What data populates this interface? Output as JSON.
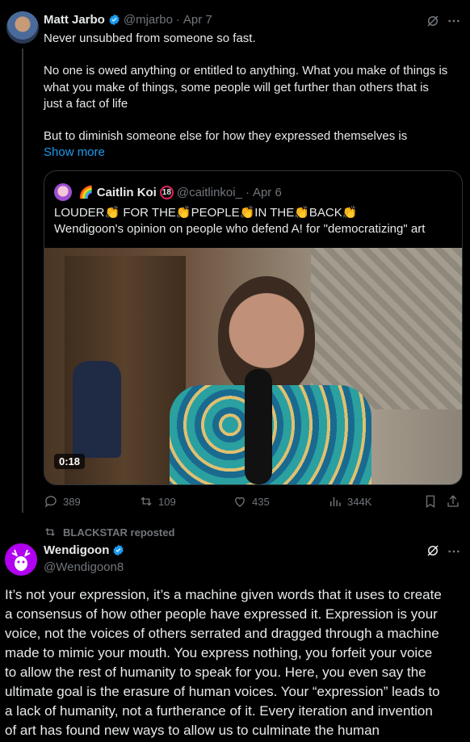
{
  "post1": {
    "author_name": "Matt Jarbo",
    "handle": "@mjarbo",
    "separator": "·",
    "date": "Apr 7",
    "text_lines": [
      "Never unsubbed from someone so fast.",
      "No one is owed anything or entitled to anything. What you make of things is",
      "what you make of things, some people will get further than others that is",
      "just a fact of life",
      "But to diminish someone else for how they expressed themselves is"
    ],
    "show_more": "Show more",
    "quote": {
      "author_emoji": "🌈",
      "author_name": "Caitlin Koi",
      "badge": "18",
      "handle": "@caitlinkoi_",
      "separator": "·",
      "date": "Apr 6",
      "line1": "LOUDER👏 FOR THE👏PEOPLE👏IN THE👏BACK👏",
      "line2": "Wendigoon's opinion on people who defend A! for \"democratizing\" art",
      "video_duration": "0:18"
    },
    "actions": {
      "replies": "389",
      "reposts": "109",
      "likes": "435",
      "views": "344K"
    }
  },
  "repost_label": "BLACKSTAR reposted",
  "post2": {
    "author_name": "Wendigoon",
    "handle": "@Wendigoon8",
    "text_lines": [
      "It’s not your expression, it’s a machine given words that it uses to create",
      "a consensus of how other people have expressed it. Expression is your",
      "voice, not the voices of others serrated and dragged through a machine",
      "made to mimic your mouth. You express nothing, you forfeit your voice",
      "to allow the rest of humanity to speak for you. Here, you even say the",
      "ultimate goal is the erasure of human voices. Your “expression” leads to",
      "a lack of humanity, not a furtherance of it. Every iteration and invention",
      "of art has found new ways to allow us to culminate the human"
    ]
  },
  "colors": {
    "background": "#000000",
    "text": "#e7e9ea",
    "muted": "#71767b",
    "link": "#1d9bf0",
    "border": "#2f3336",
    "verified": "#1d9bf0"
  }
}
